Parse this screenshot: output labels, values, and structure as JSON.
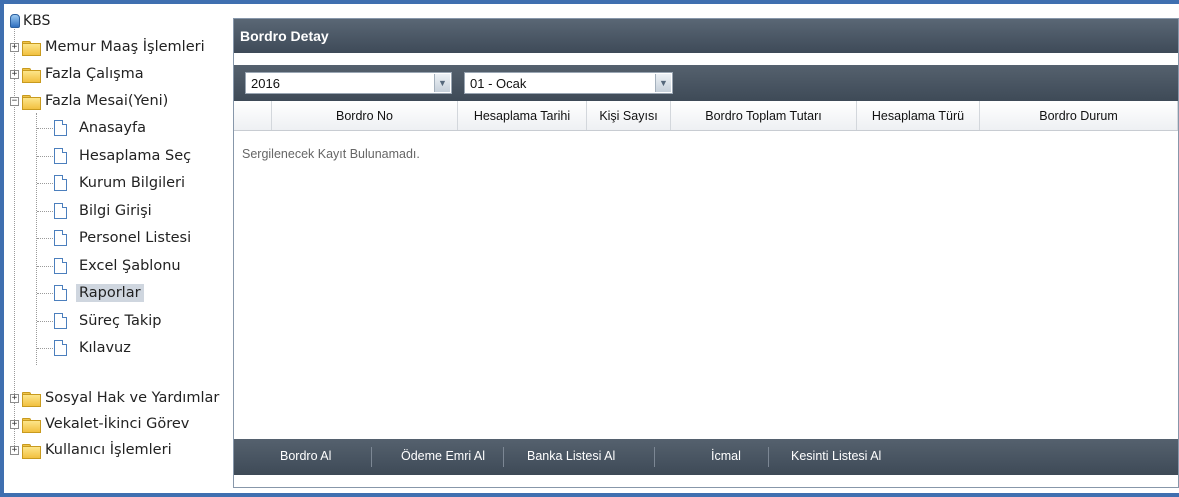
{
  "tree": {
    "root": "KBS",
    "items": [
      {
        "label": "Memur Maaş İşlemleri"
      },
      {
        "label": "Fazla Çalışma"
      },
      {
        "label": "Fazla Mesai(Yeni)"
      },
      {
        "label": "Sosyal Hak ve Yardımlar"
      },
      {
        "label": "Vekalet-İkinci Görev"
      },
      {
        "label": "Kullanıcı İşlemleri"
      }
    ],
    "children": [
      {
        "label": "Anasayfa"
      },
      {
        "label": "Hesaplama Seç"
      },
      {
        "label": "Kurum Bilgileri"
      },
      {
        "label": "Bilgi Girişi"
      },
      {
        "label": "Personel Listesi"
      },
      {
        "label": "Excel Şablonu"
      },
      {
        "label": "Raporlar",
        "selected": true
      },
      {
        "label": "Süreç Takip"
      },
      {
        "label": "Kılavuz"
      }
    ]
  },
  "panel": {
    "title": "Bordro Detay",
    "year_select": "2016",
    "month_select": "01 - Ocak",
    "columns": [
      "",
      "Bordro No",
      "Hesaplama Tarihi",
      "Kişi Sayısı",
      "Bordro Toplam Tutarı",
      "Hesaplama Türü",
      "Bordro Durum"
    ],
    "empty_message": "Sergilenecek Kayıt Bulunamadı.",
    "buttons": [
      "Bordro Al",
      "Ödeme Emri Al",
      "Banka Listesi Al",
      "İcmal",
      "Kesinti Listesi Al"
    ]
  },
  "colors": {
    "outer_border": "#3f6fb0",
    "header_bg": "#4a5665",
    "selected_bg": "#cfd6df"
  }
}
